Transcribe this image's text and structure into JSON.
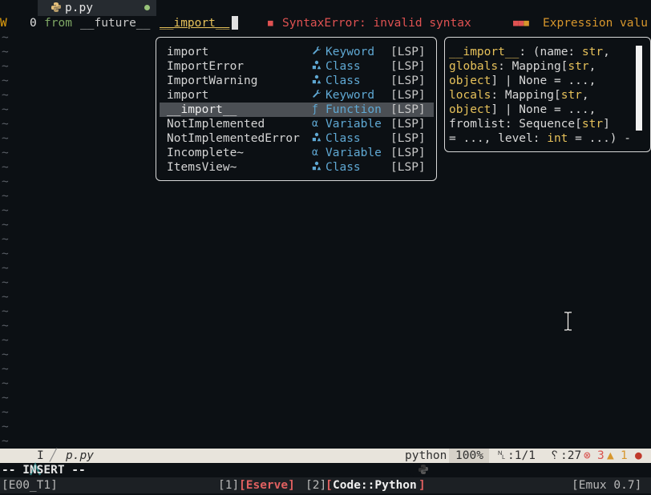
{
  "tab": {
    "filename": "p.py",
    "icon": "python-icon",
    "modified_dot_color": "#98c379"
  },
  "line1": {
    "diag_flag": "W",
    "line_number": "0",
    "code_kw": "from",
    "code_mod": "__future__",
    "code_typed": "__import__",
    "diag_error": "SyntaxError: invalid syntax",
    "diag_hint": "Expression valu"
  },
  "tilde": "~",
  "completion": {
    "items": [
      {
        "label": "import",
        "icon": "wrench-icon",
        "kind": "Keyword",
        "source": "[LSP]",
        "selected": false
      },
      {
        "label": "ImportError",
        "icon": "class-icon",
        "kind": "Class",
        "source": "[LSP]",
        "selected": false
      },
      {
        "label": "ImportWarning",
        "icon": "class-icon",
        "kind": "Class",
        "source": "[LSP]",
        "selected": false
      },
      {
        "label": "import",
        "icon": "wrench-icon",
        "kind": "Keyword",
        "source": "[LSP]",
        "selected": false
      },
      {
        "label": "__import__",
        "icon": "function-icon",
        "kind": "Function",
        "source": "[LSP]",
        "selected": true
      },
      {
        "label": "NotImplemented",
        "icon": "variable-icon",
        "kind": "Variable",
        "source": "[LSP]",
        "selected": false
      },
      {
        "label": "NotImplementedError",
        "icon": "class-icon",
        "kind": "Class",
        "source": "[LSP]",
        "selected": false
      },
      {
        "label": "Incomplete~",
        "icon": "variable-icon",
        "kind": "Variable",
        "source": "[LSP]",
        "selected": false
      },
      {
        "label": "ItemsView~",
        "icon": "class-icon",
        "kind": "Class",
        "source": "[LSP]",
        "selected": false
      }
    ]
  },
  "doc": {
    "lines": [
      [
        [
          "__import__",
          "c-func"
        ],
        [
          ": (name: ",
          "c-plain"
        ],
        [
          "str",
          "c-type"
        ],
        [
          ",",
          "c-plain"
        ]
      ],
      [
        [
          "globals",
          "c-func"
        ],
        [
          ": Mapping[",
          "c-plain"
        ],
        [
          "str",
          "c-type"
        ],
        [
          ",",
          "c-plain"
        ]
      ],
      [
        [
          "object",
          "c-type"
        ],
        [
          "] | None = ...,",
          "c-plain"
        ]
      ],
      [
        [
          "locals",
          "c-func"
        ],
        [
          ": Mapping[",
          "c-plain"
        ],
        [
          "str",
          "c-type"
        ],
        [
          ",",
          "c-plain"
        ]
      ],
      [
        [
          "object",
          "c-type"
        ],
        [
          "] | None = ...,",
          "c-plain"
        ]
      ],
      [
        [
          "fromlist: Sequence[",
          "c-plain"
        ],
        [
          "str",
          "c-type"
        ],
        [
          "]",
          "c-plain"
        ]
      ],
      [
        [
          "= ..., level: ",
          "c-plain"
        ],
        [
          "int",
          "c-type"
        ],
        [
          " = ...) -",
          "c-plain"
        ]
      ]
    ]
  },
  "statusline": {
    "mode_short": "I",
    "filename": "p.py",
    "filetype": "python",
    "percent": "100%",
    "position": ":1/1",
    "column": ":27",
    "errors": "3",
    "warnings": "1"
  },
  "cmdline": "-- INSERT --",
  "bottombar": {
    "session": "[E00_T1]",
    "win1_num": "[1]",
    "win1_name": "[Eserve]",
    "win2_num": "[2]",
    "win2_name": "[Code::Python]",
    "version": "[Emux 0.7]"
  }
}
